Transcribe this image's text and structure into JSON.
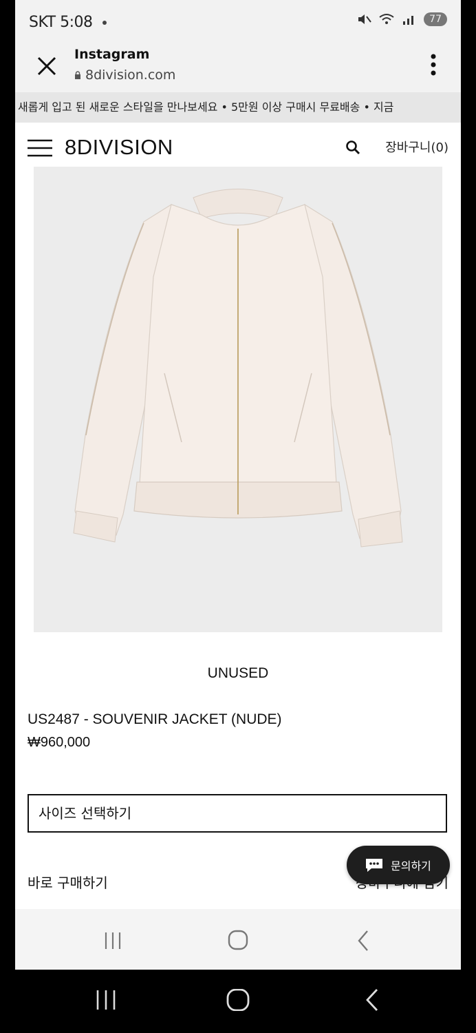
{
  "status_bar": {
    "left_text": "SKT 5:08",
    "right_badge": "77"
  },
  "browser": {
    "app_title": "Instagram",
    "url": "8division.com"
  },
  "marquee": {
    "text": "새롭게 입고 된 새로운 스타일을 만나보세요  •  5만원 이상 구매시 무료배송  •  지금"
  },
  "site_header": {
    "logo": "8DIVISION",
    "cart_label": "장바구니(0)"
  },
  "product": {
    "brand": "UNUSED",
    "name": "US2487 - SOUVENIR JACKET (NUDE)",
    "price": "₩960,000",
    "size_select_label": "사이즈 선택하기",
    "buy_now_label": "바로 구매하기",
    "add_to_cart_label": "장바구니에 담기"
  },
  "chat": {
    "label": "문의하기"
  },
  "icons": [
    "close-icon",
    "lock-icon",
    "more-vertical-icon",
    "menu-icon",
    "search-icon",
    "chat-icon",
    "recent-apps-icon",
    "home-icon",
    "back-icon"
  ],
  "colors": {
    "image_bg": "#ececec",
    "chat_bg": "#1e1e1e"
  }
}
